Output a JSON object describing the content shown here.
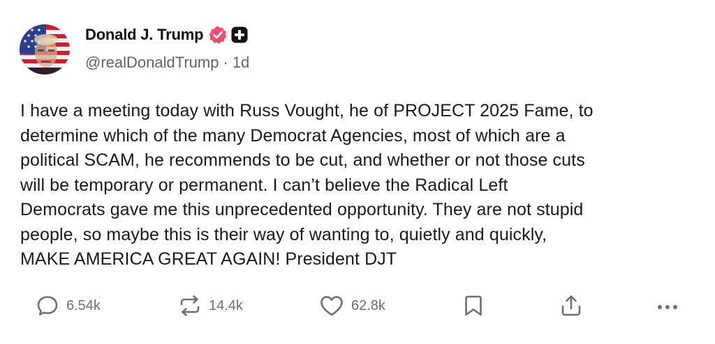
{
  "author": {
    "name": "Donald J. Trump",
    "handle": "@realDonaldTrump",
    "separator": "·",
    "time": "1d",
    "avatar_icon": "flag-portrait-avatar",
    "verified_icon": "verified-badge-icon",
    "verified_color": "#e7526c"
  },
  "post": {
    "text": "I have a meeting today with Russ Vought, he of PROJECT 2025 Fame,  to\ndetermine which of the many Democrat Agencies, most of which are a\npolitical SCAM, he recommends to be cut, and whether or not those cuts\nwill be temporary or permanent. I can’t believe the Radical Left\nDemocrats gave me this unprecedented opportunity. They are not stupid\npeople, so maybe this is their way of wanting to, quietly and quickly,\nMAKE AMERICA GREAT AGAIN! President DJT"
  },
  "actions": {
    "replies": "6.54k",
    "reposts": "14.4k",
    "likes": "62.8k"
  },
  "colors": {
    "text": "#1a1a1a",
    "secondary": "#5f6368",
    "icon": "#6b6f76"
  }
}
